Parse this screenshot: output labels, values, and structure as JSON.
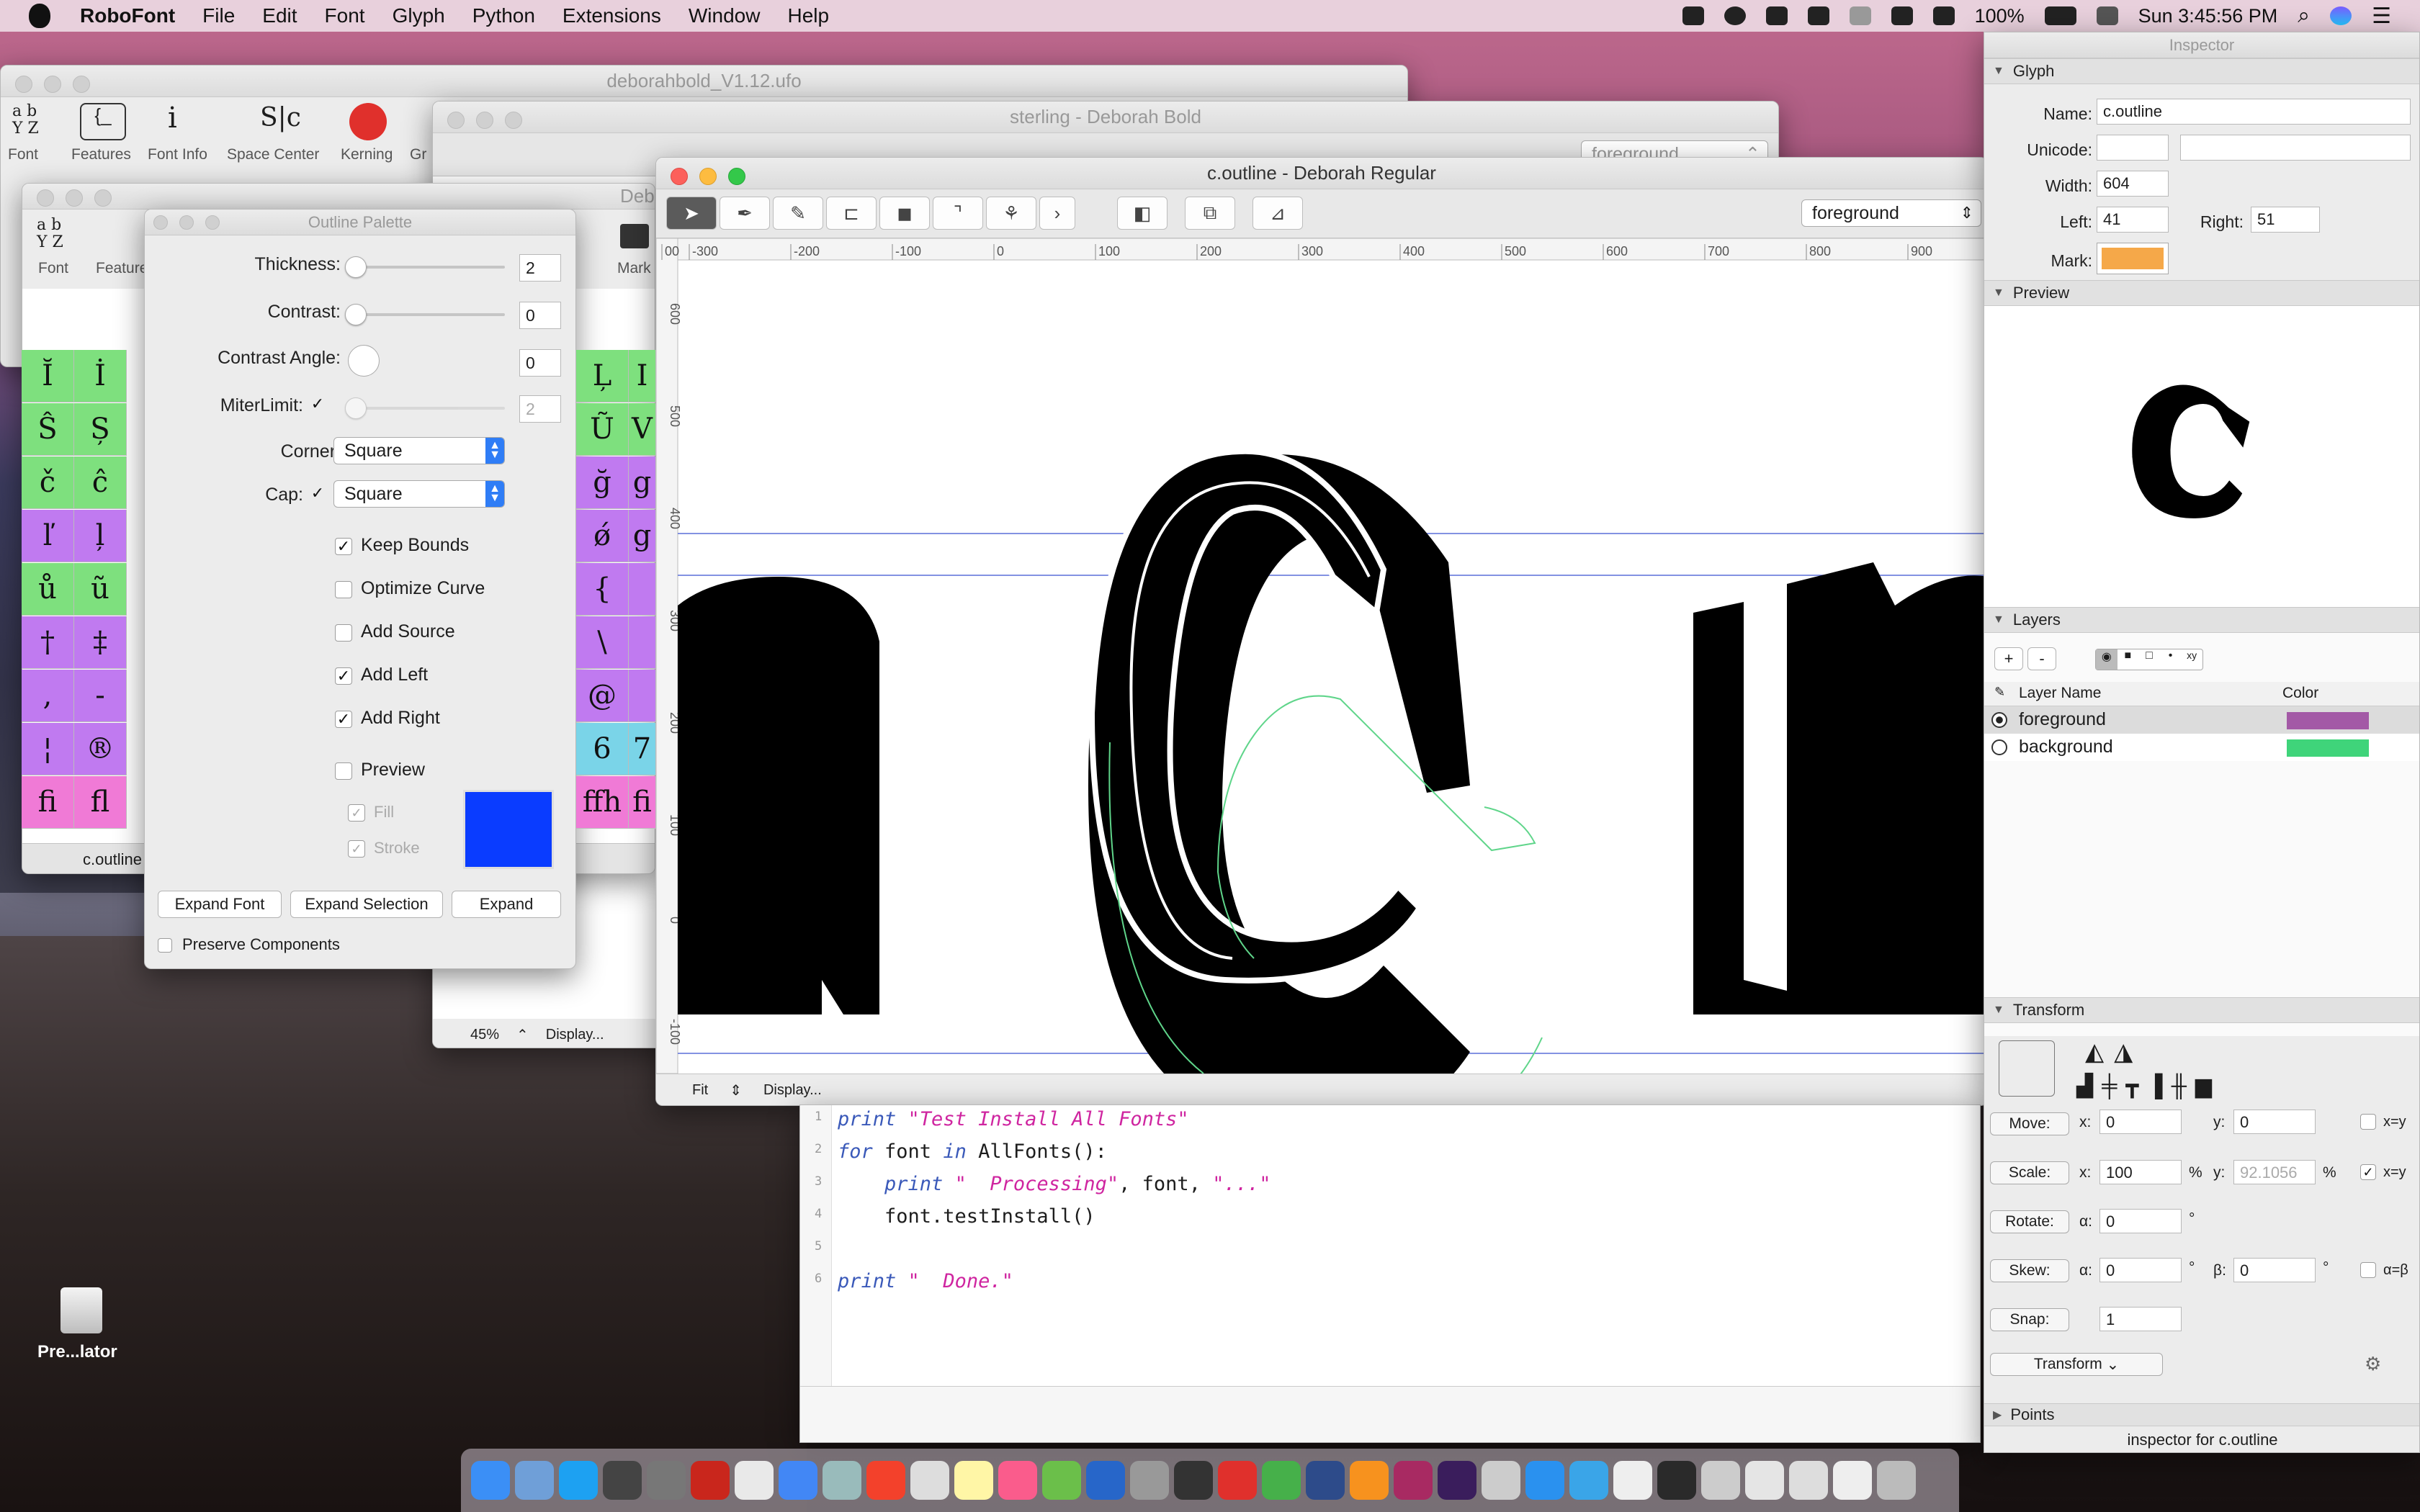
{
  "menubar": {
    "app": "RoboFont",
    "items": [
      "File",
      "Edit",
      "Font",
      "Glyph",
      "Python",
      "Extensions",
      "Window",
      "Help"
    ],
    "battery": "100%",
    "clock": "Sun 3:45:56 PM"
  },
  "windows": {
    "font_window": {
      "title": "deborahbold_V1.12.ufo",
      "toolbar": [
        "Font",
        "Features",
        "Font Info",
        "Space Center",
        "Kerning",
        "Gr"
      ]
    },
    "sterling": {
      "title": "sterling - Deborah Bold",
      "layer": "foreground",
      "zoom": "45%",
      "display": "Display..."
    },
    "font_window2": {
      "title": "Debo",
      "toolbar": [
        "Font",
        "Feature",
        "Mark"
      ],
      "status": "c.outline"
    },
    "main": {
      "title": "c.outline - Deborah Regular",
      "layer": "foreground",
      "zoom": "Fit",
      "display": "Display...",
      "ruler_h": [
        "00",
        "-300",
        "-200",
        "-100",
        "0",
        "100",
        "200",
        "300",
        "400",
        "500",
        "600",
        "700",
        "800",
        "900"
      ],
      "ruler_v": [
        "600",
        "500",
        "400",
        "300",
        "200",
        "100",
        "0",
        "-100"
      ]
    }
  },
  "glyph_grid": {
    "left": [
      "Ĭ",
      "İ",
      "Ŝ",
      "Ș",
      "č",
      "ĉ",
      "ľ",
      "ļ",
      "ů",
      "ũ",
      "†",
      "‡",
      ",",
      "-",
      "¦",
      "®",
      "ﬁ",
      "ﬂ"
    ],
    "right": [
      "Ļ",
      "I",
      "Ũ",
      "V",
      "ğ",
      "g",
      "ǿ",
      "g",
      "{",
      "",
      "\\",
      "",
      "@",
      "",
      "6",
      "7",
      "ﬀh",
      "fi"
    ]
  },
  "outline_palette": {
    "title": "Outline Palette",
    "thickness_label": "Thickness:",
    "thickness": "2",
    "contrast_label": "Contrast:",
    "contrast": "0",
    "contrast_angle_label": "Contrast Angle:",
    "contrast_angle": "0",
    "miter_label": "MiterLimit:",
    "miter": "2",
    "corner_label": "Corner:",
    "corner": "Square",
    "cap_label": "Cap:",
    "cap": "Square",
    "options": [
      {
        "label": "Keep Bounds",
        "checked": true
      },
      {
        "label": "Optimize Curve",
        "checked": false
      },
      {
        "label": "Add Source",
        "checked": false
      },
      {
        "label": "Add Left",
        "checked": true
      },
      {
        "label": "Add Right",
        "checked": true
      }
    ],
    "preview": "Preview",
    "fill": "Fill",
    "stroke": "Stroke",
    "preview_color": "#0a3cff",
    "buttons": [
      "Expand Font",
      "Expand Selection",
      "Expand"
    ],
    "preserve": "Preserve Components"
  },
  "inspector": {
    "title": "Inspector",
    "glyph": {
      "section": "Glyph",
      "name_label": "Name:",
      "name": "c.outline",
      "unicode_label": "Unicode:",
      "unicode": "",
      "width_label": "Width:",
      "width": "604",
      "left_label": "Left:",
      "left": "41",
      "right_label": "Right:",
      "right": "51",
      "mark_label": "Mark:",
      "mark_color": "#f5a849"
    },
    "preview": {
      "section": "Preview"
    },
    "layers": {
      "section": "Layers",
      "add": "+",
      "remove": "-",
      "col_name": "Layer Name",
      "col_color": "Color",
      "rows": [
        {
          "name": "foreground",
          "color": "#a359a6"
        },
        {
          "name": "background",
          "color": "#3fd47a"
        }
      ]
    },
    "transform": {
      "section": "Transform",
      "move": "Move:",
      "move_x": "0",
      "move_y": "0",
      "xy": "x=y",
      "scale": "Scale:",
      "scale_x": "100",
      "scale_y": "92.1056",
      "pct": "%",
      "rotate": "Rotate:",
      "rotate_a": "0",
      "skew": "Skew:",
      "skew_a": "0",
      "skew_b": "0",
      "ab": "α=β",
      "snap": "Snap:",
      "snap_v": "1",
      "transform_btn": "Transform",
      "alpha": "α:",
      "beta": "β:",
      "xl": "x:",
      "yl": "y:",
      "deg": "°"
    },
    "points": {
      "section": "Points"
    },
    "footer": "inspector for c.outline"
  },
  "script": {
    "lines": [
      "print \"Test Install All Fonts\"",
      "for font in AllFonts():",
      "    print \"  Processing\", font, \"...\"",
      "    font.testInstall()",
      "",
      "print \"  Done.\""
    ],
    "line_numbers": [
      "1",
      "2",
      "3",
      "4",
      "5",
      "6"
    ]
  },
  "desktop": {
    "drive_label": "Pre...lator"
  }
}
